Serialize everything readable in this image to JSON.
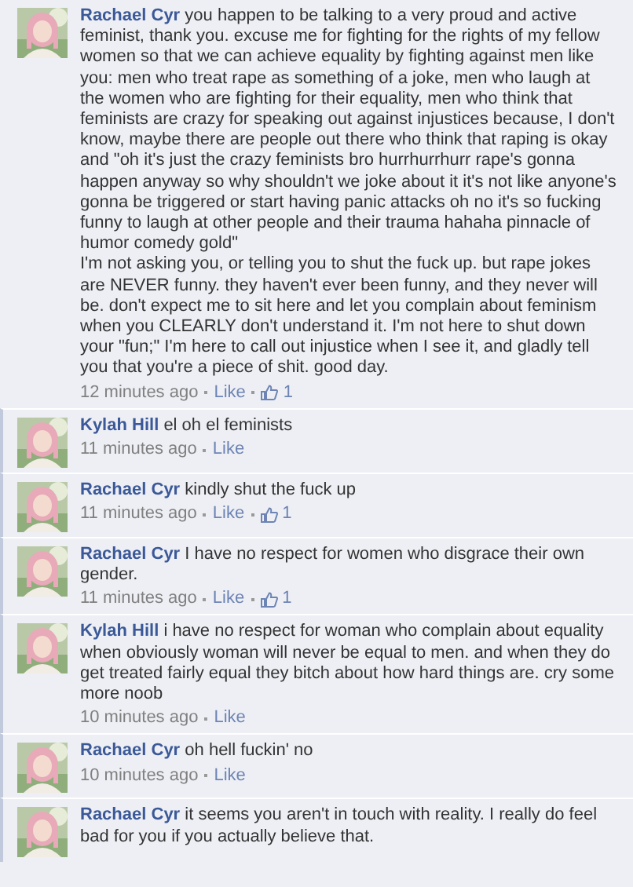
{
  "comments": [
    {
      "author": "Rachael Cyr",
      "text": "you happen to be talking to a very proud and active feminist, thank you. excuse me for fighting for the rights of my fellow women so that we can achieve equality by fighting against men like you: men who treat rape as something of a joke, men who laugh at the women who are fighting for their equality, men who think that feminists are crazy for speaking out against injustices because, I don't know, maybe there are people out there who think that raping is okay and \"oh it's just the crazy feminists bro hurrhurrhurr rape's gonna happen anyway so why shouldn't we joke about it it's not like anyone's gonna be triggered or start having panic attacks oh no it's so fucking funny to laugh at other people and their trauma hahaha pinnacle of humor comedy gold\"\nI'm not asking you, or telling you to shut the fuck up. but rape jokes are NEVER funny. they haven't ever been funny, and they never will be. don't expect me to sit here and let you complain about feminism when you CLEARLY don't understand it. I'm not here to shut down your \"fun;\" I'm here to call out injustice when I see it, and gladly tell you that you're a piece of shit. good day.",
      "time": "12 minutes ago",
      "like_label": "Like",
      "likes": "1"
    },
    {
      "author": "Kylah Hill",
      "text": "el oh el feminists",
      "time": "11 minutes ago",
      "like_label": "Like"
    },
    {
      "author": "Rachael Cyr",
      "text": "kindly shut the fuck up",
      "time": "11 minutes ago",
      "like_label": "Like",
      "likes": "1"
    },
    {
      "author": "Rachael Cyr",
      "text": "I have no respect for women who disgrace their own gender.",
      "time": "11 minutes ago",
      "like_label": "Like",
      "likes": "1"
    },
    {
      "author": "Kylah Hill",
      "text": "i have no respect for woman who complain about equality when obviously woman will never be equal to men. and when they do get treated fairly equal they bitch about how hard things are. cry some more noob",
      "time": "10 minutes ago",
      "like_label": "Like"
    },
    {
      "author": "Rachael Cyr",
      "text": "oh hell fuckin' no",
      "time": "10 minutes ago",
      "like_label": "Like"
    },
    {
      "author": "Rachael Cyr",
      "text": "it seems you aren't in touch with reality. I really do feel bad for you if you actually believe that."
    }
  ]
}
